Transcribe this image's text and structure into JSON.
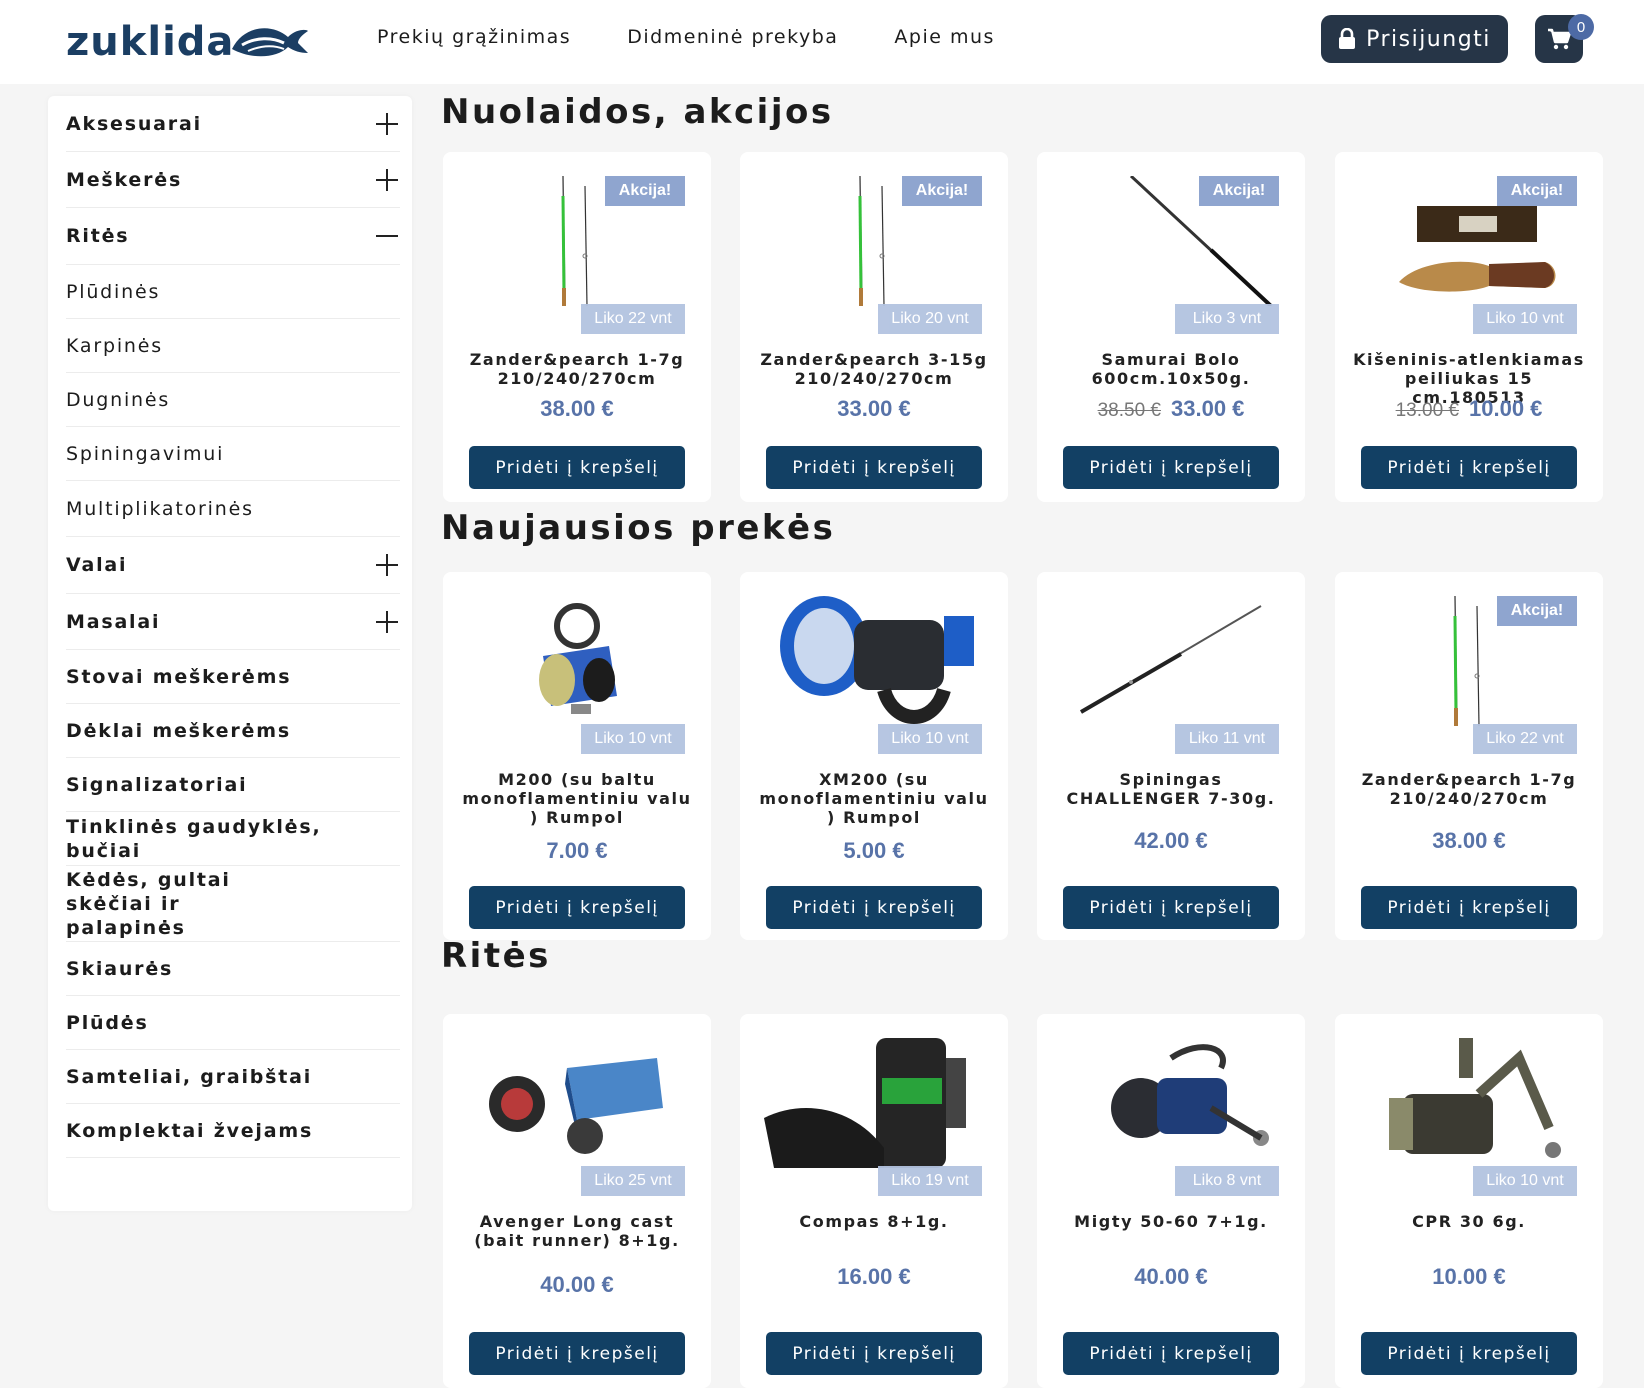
{
  "header": {
    "logo_text": "zuklida",
    "nav": [
      "Prekių grąžinimas",
      "Didmeninė prekyba",
      "Apie mus"
    ],
    "login_label": "Prisijungti",
    "cart_count": "0"
  },
  "sidebar": {
    "categories": [
      {
        "label": "Aksesuarai",
        "toggle": "plus"
      },
      {
        "label": "Meškerės",
        "toggle": "plus"
      },
      {
        "label": "Ritės",
        "toggle": "minus"
      },
      {
        "label": "Plūdinės",
        "toggle": "none"
      },
      {
        "label": "Karpinės",
        "toggle": "none"
      },
      {
        "label": "Dugninės",
        "toggle": "none"
      },
      {
        "label": "Spiningavimui",
        "toggle": "none"
      },
      {
        "label": "Multiplikatorinės",
        "toggle": "none"
      },
      {
        "label": "Valai",
        "toggle": "plus"
      },
      {
        "label": "Masalai",
        "toggle": "plus"
      },
      {
        "label": "Stovai meškerėms",
        "toggle": "none"
      },
      {
        "label": "Dėklai meškerėms",
        "toggle": "none"
      },
      {
        "label": "Signalizatoriai",
        "toggle": "none"
      },
      {
        "label": "Tinklinės gaudyklės, bučiai",
        "toggle": "none"
      },
      {
        "label": "Kėdės, gultai skėčiai ir palapinės",
        "toggle": "none"
      },
      {
        "label": "Skiaurės",
        "toggle": "none"
      },
      {
        "label": "Plūdės",
        "toggle": "none"
      },
      {
        "label": "Samteliai, graibštai",
        "toggle": "none"
      },
      {
        "label": "Komplektai žvejams",
        "toggle": "none"
      }
    ]
  },
  "sections": [
    {
      "title": "Nuolaidos, akcijos",
      "products": [
        {
          "name": "Zander&pearch 1-7g 210/240/270cm",
          "price": "38.00 €",
          "old_price": "",
          "stock": "Liko 22 vnt",
          "sale": "Akcija!",
          "image": "rod-green"
        },
        {
          "name": "Zander&pearch 3-15g 210/240/270cm",
          "price": "33.00 €",
          "old_price": "",
          "stock": "Liko 20 vnt",
          "sale": "Akcija!",
          "image": "rod-green"
        },
        {
          "name": "Samurai Bolo 600cm.10x50g.",
          "price": "33.00 €",
          "old_price": "38.50 €",
          "stock": "Liko 3 vnt",
          "sale": "Akcija!",
          "image": "rod-black"
        },
        {
          "name": "Kišeninis-atlenkiamas peiliukas 15 cm.180513",
          "price": "10.00 €",
          "old_price": "13.00 €",
          "stock": "Liko 10 vnt",
          "sale": "Akcija!",
          "image": "knife"
        }
      ]
    },
    {
      "title": "Naujausios prekės",
      "products": [
        {
          "name": "M200 (su baltu monoflamentiniu valu ) Rumpol",
          "price": "7.00 €",
          "old_price": "",
          "stock": "Liko 10 vnt",
          "sale": "",
          "image": "reel-blue-small"
        },
        {
          "name": "XM200 (su monoflamentiniu valu ) Rumpol",
          "price": "5.00 €",
          "old_price": "",
          "stock": "Liko 10 vnt",
          "sale": "",
          "image": "reel-blue-big"
        },
        {
          "name": "Spiningas CHALLENGER 7-30g.",
          "price": "42.00 €",
          "old_price": "",
          "stock": "Liko 11 vnt",
          "sale": "",
          "image": "rod-spin"
        },
        {
          "name": "Zander&pearch 1-7g 210/240/270cm",
          "price": "38.00 €",
          "old_price": "",
          "stock": "Liko 22 vnt",
          "sale": "Akcija!",
          "image": "rod-green"
        }
      ]
    },
    {
      "title": "Ritės",
      "products": [
        {
          "name": "Avenger Long cast (bait runner) 8+1g.",
          "price": "40.00 €",
          "old_price": "",
          "stock": "Liko 25 vnt",
          "sale": "",
          "image": "reel-box"
        },
        {
          "name": "Compas 8+1g.",
          "price": "16.00 €",
          "old_price": "",
          "stock": "Liko 19 vnt",
          "sale": "",
          "image": "reel-green"
        },
        {
          "name": "Migty 50-60 7+1g.",
          "price": "40.00 €",
          "old_price": "",
          "stock": "Liko 8 vnt",
          "sale": "",
          "image": "reel-dark"
        },
        {
          "name": "CPR 30 6g.",
          "price": "10.00 €",
          "old_price": "",
          "stock": "Liko 10 vnt",
          "sale": "",
          "image": "reel-olive"
        }
      ]
    }
  ],
  "add_to_cart_label": "Pridėti į krepšelį",
  "colors": {
    "header_button": "#263547",
    "price": "#5873a8",
    "add_button": "#124064",
    "sale_badge": "#8fa5cf",
    "stock_badge": "#b3c3e0"
  }
}
